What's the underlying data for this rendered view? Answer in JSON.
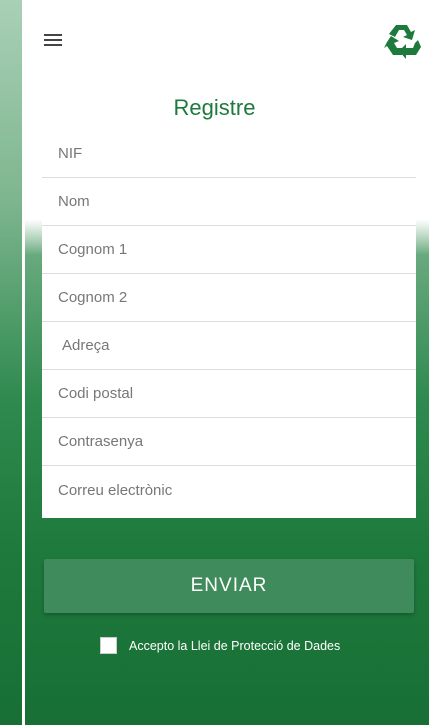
{
  "header": {
    "menu_icon": "hamburger-menu-icon",
    "logo_icon": "recycle-icon",
    "accent_color": "#1e7a3c"
  },
  "form": {
    "title": "Registre",
    "fields": [
      {
        "placeholder": "NIF"
      },
      {
        "placeholder": "Nom"
      },
      {
        "placeholder": "Cognom 1"
      },
      {
        "placeholder": "Cognom 2"
      },
      {
        "placeholder": "Adreça"
      },
      {
        "placeholder": "Codi postal"
      },
      {
        "placeholder": "Contrasenya"
      },
      {
        "placeholder": "Correu electrònic"
      }
    ],
    "submit_label": "ENVIAR",
    "consent_label": "Accepto la Llei de Protecció de Dades",
    "consent_checked": false
  },
  "colors": {
    "background": "#1f7a3d",
    "button": "#3f8b5b",
    "field_text": "#777777"
  }
}
